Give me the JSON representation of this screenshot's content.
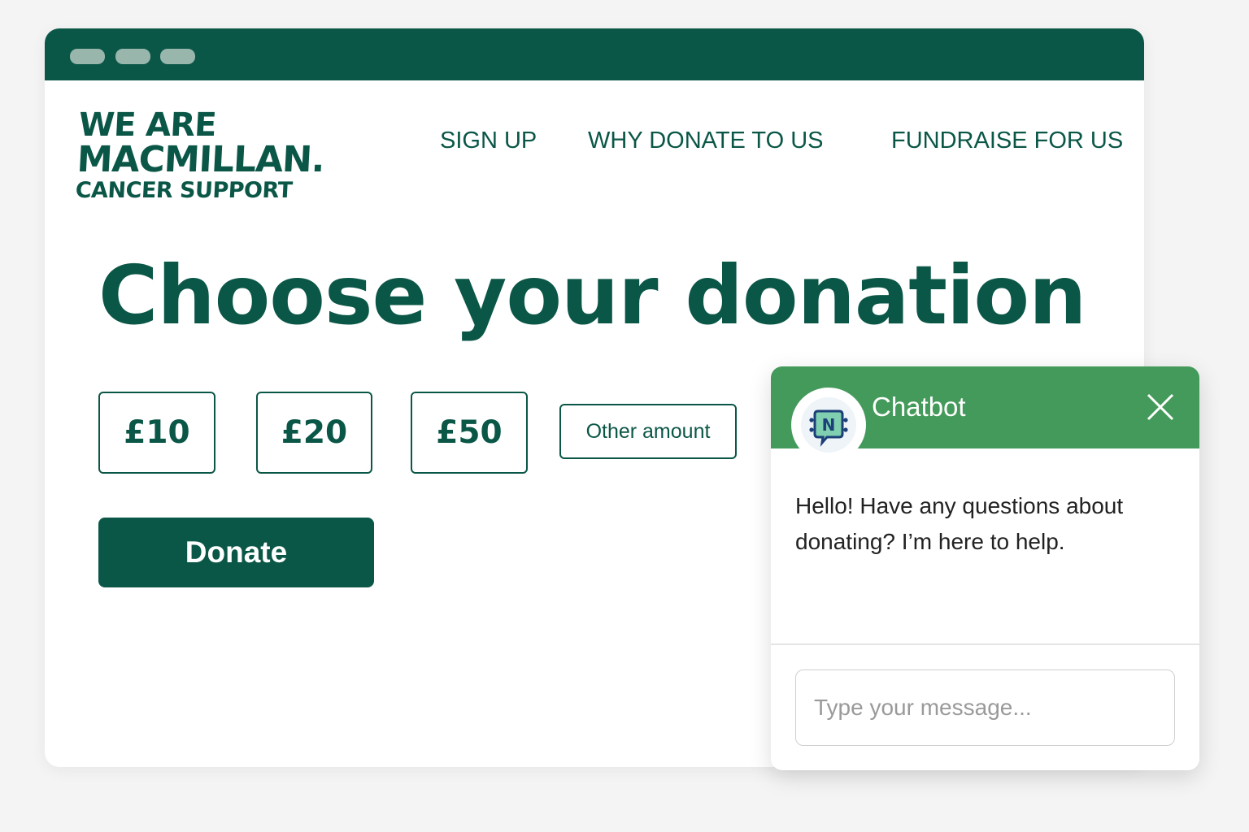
{
  "brand": {
    "line1": "WE ARE",
    "line2": "MACMILLAN.",
    "line3": "CANCER SUPPORT",
    "primary_color": "#0b5747",
    "chat_color": "#449a5a"
  },
  "nav": {
    "items": [
      {
        "label": "SIGN UP"
      },
      {
        "label": "WHY DONATE TO US"
      },
      {
        "label": "FUNDRAISE FOR US"
      }
    ]
  },
  "main": {
    "title": "Choose your donation",
    "amounts": [
      {
        "label": "£10"
      },
      {
        "label": "£20"
      },
      {
        "label": "£50"
      },
      {
        "label": "Other amount"
      }
    ],
    "donate_label": "Donate"
  },
  "chatbot": {
    "title": "Chatbot",
    "avatar_letter": "N",
    "avatar_icon": "chat-bot-icon",
    "close_icon": "close-icon",
    "message": "Hello! Have any questions about donating? I’m here to help.",
    "input_placeholder": "Type your message...",
    "input_value": ""
  }
}
